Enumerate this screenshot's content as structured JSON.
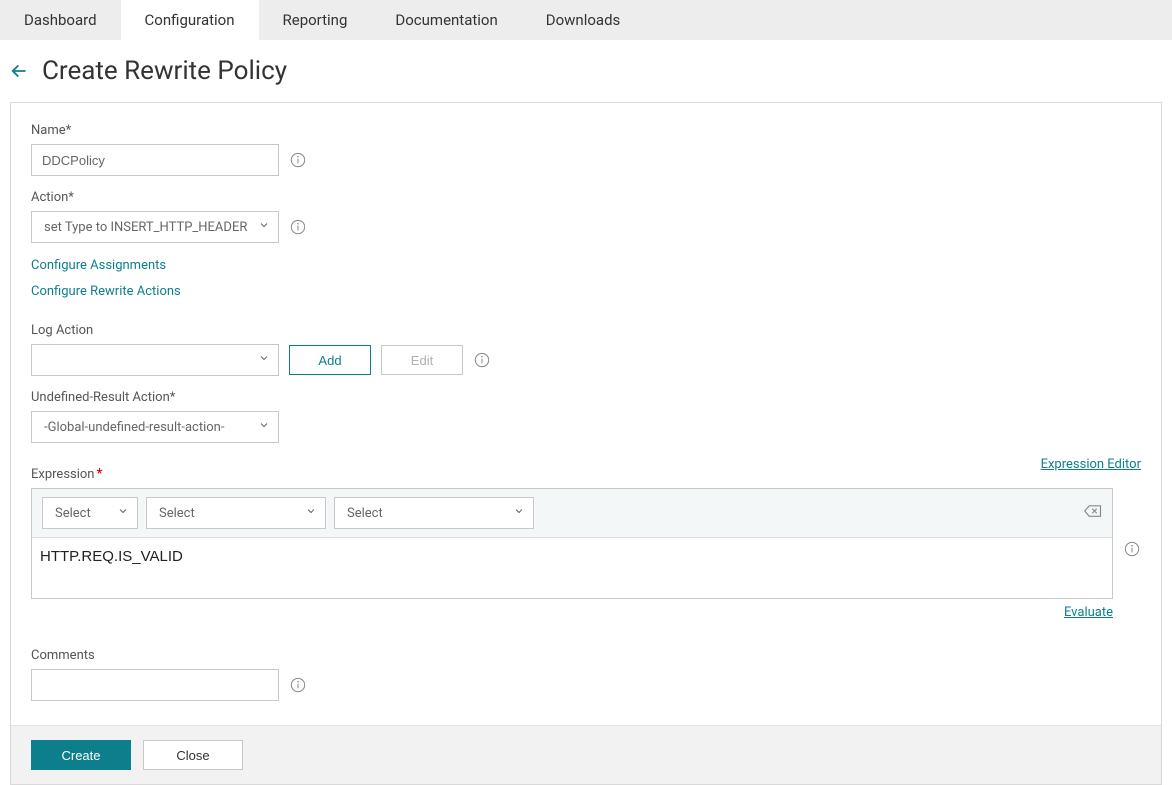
{
  "tabs": {
    "dashboard": "Dashboard",
    "configuration": "Configuration",
    "reporting": "Reporting",
    "documentation": "Documentation",
    "downloads": "Downloads",
    "active": "configuration"
  },
  "title": "Create Rewrite Policy",
  "form": {
    "name_label": "Name*",
    "name_value": "DDCPolicy",
    "action_label": "Action*",
    "action_value": "set Type to INSERT_HTTP_HEADER",
    "configure_assignments": "Configure Assignments",
    "configure_rewrite_actions": "Configure Rewrite Actions",
    "log_action_label": "Log Action",
    "log_action_value": "",
    "add_btn": "Add",
    "edit_btn": "Edit",
    "undef_label": "Undefined-Result Action*",
    "undef_value": "-Global-undefined-result-action-",
    "expression_label": "Expression",
    "expression_editor_link": "Expression Editor",
    "expr_sel1": "Select",
    "expr_sel2": "Select",
    "expr_sel3": "Select",
    "expression_value": "HTTP.REQ.IS_VALID",
    "evaluate_link": "Evaluate",
    "comments_label": "Comments",
    "comments_value": ""
  },
  "footer": {
    "create": "Create",
    "close": "Close"
  }
}
